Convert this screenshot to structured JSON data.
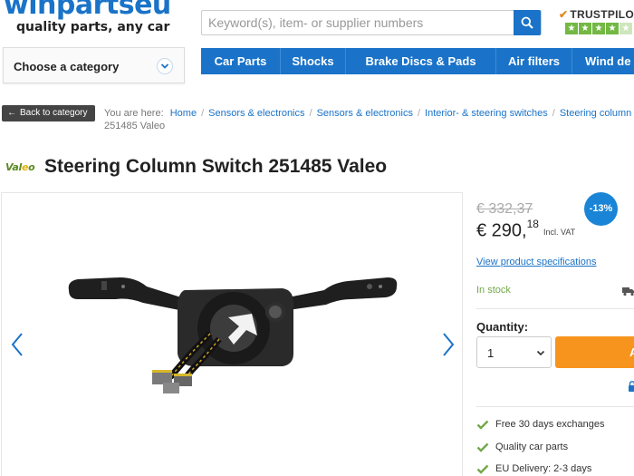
{
  "header": {
    "logo_text": "winpartseu",
    "tagline": "quality parts, any car",
    "search_placeholder": "Keyword(s), item- or supplier numbers",
    "trustpilot_label": "TRUSTPILOT"
  },
  "category": {
    "label": "Choose a category"
  },
  "nav": {
    "items": [
      {
        "label": "Car Parts"
      },
      {
        "label": "Shocks"
      },
      {
        "label": "Brake Discs & Pads"
      },
      {
        "label": "Air filters"
      },
      {
        "label": "Wind de"
      }
    ]
  },
  "breadcrumb": {
    "back_label": "Back to category",
    "intro": "You are here:",
    "items": [
      "Home",
      "Sensors & electronics",
      "Sensors & electronics",
      "Interior- & steering switches",
      "Steering column switch"
    ],
    "current": "251485 Valeo"
  },
  "product": {
    "brand": "Valeo",
    "title": "Steering Column Switch 251485 Valeo",
    "old_price": "€ 332,37",
    "discount": "-13%",
    "price_main": "€ 290,",
    "price_cents": "18",
    "vat_note": "Incl. VAT",
    "spec_link": "View product specifications",
    "stock": "In stock",
    "quantity_label": "Quantity:",
    "quantity_value": "1",
    "cart_label": "A"
  },
  "usps": [
    {
      "text": "Free 30 days exchanges"
    },
    {
      "text": "Quality car parts"
    },
    {
      "text": "EU Delivery: 2-3 days"
    }
  ],
  "colors": {
    "brand_blue": "#1a73c8",
    "cart_orange": "#f7941d",
    "stock_green": "#73a84a",
    "trust_green": "#73b843"
  },
  "icons": [
    "search-icon",
    "chevron-down-icon",
    "arrow-left-icon",
    "chevron-left-icon",
    "chevron-right-icon",
    "truck-icon",
    "lock-icon",
    "check-icon",
    "star-icon"
  ]
}
